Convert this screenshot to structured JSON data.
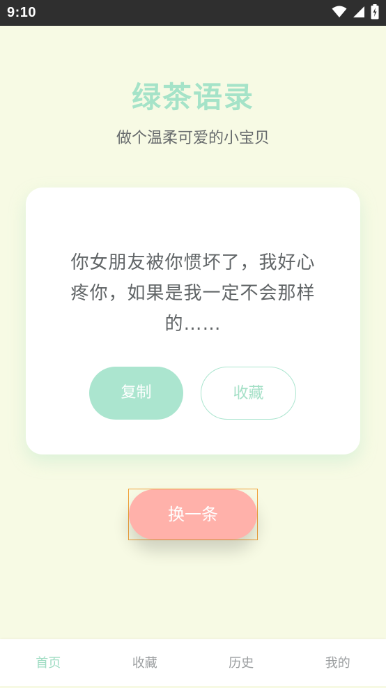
{
  "status_bar": {
    "time": "9:10",
    "icons": [
      "wifi-icon",
      "signal-icon",
      "battery-icon"
    ]
  },
  "header": {
    "title": "绿茶语录",
    "subtitle": "做个温柔可爱的小宝贝"
  },
  "card": {
    "quote": "你女朋友被你惯坏了，我好心疼你，如果是我一定不会那样的……",
    "copy_label": "复制",
    "favorite_label": "收藏"
  },
  "next_button_label": "换一条",
  "bottom_nav": {
    "items": [
      {
        "label": "首页",
        "active": true
      },
      {
        "label": "收藏",
        "active": false
      },
      {
        "label": "历史",
        "active": false
      },
      {
        "label": "我的",
        "active": false
      }
    ]
  },
  "colors": {
    "background": "#f7fae4",
    "accent_green": "#abe5cf",
    "accent_pink": "#ffb1aa",
    "text_gray": "#606466",
    "status_bar": "#2f2f2f"
  }
}
